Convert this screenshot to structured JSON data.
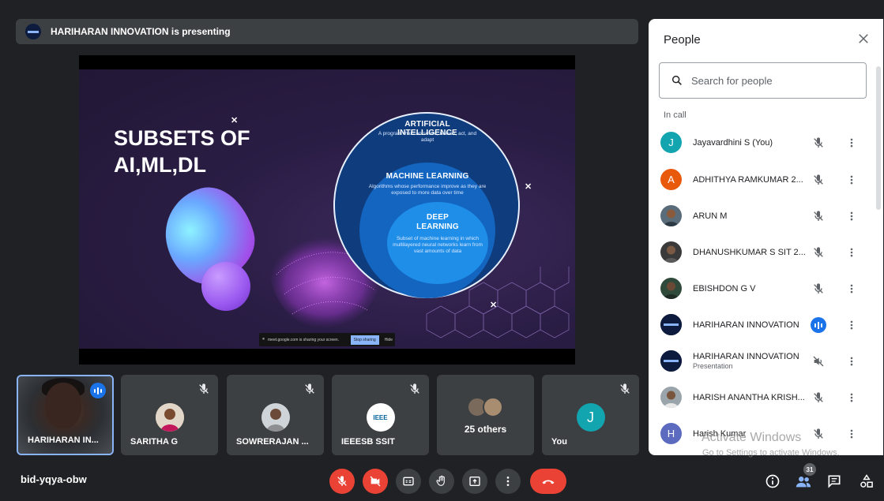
{
  "presenting": {
    "text": "HARIHARAN INNOVATION is presenting"
  },
  "slide": {
    "title_line1": "SUBSETS OF",
    "title_line2": "AI,ML,DL",
    "ai_title": "ARTIFICIAL INTELLIGENCE",
    "ai_desc": "A program that can sense, reason, act, and adapt",
    "ml_title": "MACHINE LEARNING",
    "ml_desc": "Algorithms whose performance improve as they are exposed to more data over time",
    "dl_title_line1": "DEEP",
    "dl_title_line2": "LEARNING",
    "dl_desc": "Subset of machine learning in which multilayered neural networks learn from vast amounts of data",
    "share_notice": "meet.google.com is sharing your screen.",
    "stop_sharing": "Stop sharing",
    "hide": "Hide"
  },
  "tiles": [
    {
      "name": "HARIHARAN IN..."
    },
    {
      "name": "SARITHA G"
    },
    {
      "name": "SOWRERAJAN ..."
    },
    {
      "name": "IEEESB SSIT",
      "logo_text": "IEEE"
    },
    {
      "name": "25 others"
    },
    {
      "name": "You",
      "initial": "J"
    }
  ],
  "meeting_code": "bid-yqya-obw",
  "people_count": "31",
  "panel": {
    "title": "People",
    "search_placeholder": "Search for people",
    "section": "In call",
    "people": [
      {
        "name": "Jayavardhini S (You)",
        "initial": "J",
        "color": "#12a4af"
      },
      {
        "name": "ADHITHYA RAMKUMAR 2...",
        "initial": "A",
        "color": "#e8590c"
      },
      {
        "name": "ARUN M"
      },
      {
        "name": "DHANUSHKUMAR S SIT 2..."
      },
      {
        "name": "EBISHDON G V"
      },
      {
        "name": "HARIHARAN INNOVATION"
      },
      {
        "name": "HARIHARAN INNOVATION",
        "sub": "Presentation"
      },
      {
        "name": "HARISH ANANTHA KRISH..."
      },
      {
        "name": "Harish Kumar",
        "initial": "H",
        "color": "#5c6bc0"
      }
    ]
  },
  "watermark": {
    "title": "Activate Windows",
    "subtitle": "Go to Settings to activate Windows."
  },
  "colors": {
    "background": "#202124",
    "tile": "#3c4043",
    "accent_blue": "#1a73e8",
    "danger_red": "#ea4335"
  }
}
